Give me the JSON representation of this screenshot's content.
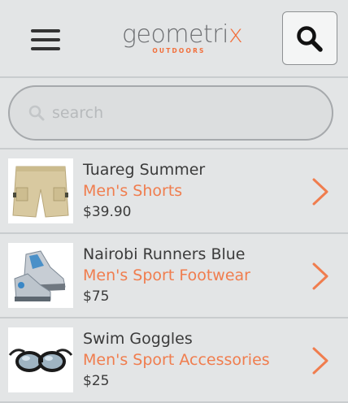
{
  "header": {
    "logo_main": "geometri",
    "logo_accent": "x",
    "logo_sub": "OUTDOORS",
    "menu_icon": "hamburger-menu-icon",
    "search_icon": "magnifier-icon"
  },
  "search": {
    "placeholder": "search",
    "value": ""
  },
  "products": [
    {
      "name": "Tuareg Summer",
      "category": "Men's Shorts",
      "price": "$39.90"
    },
    {
      "name": "Nairobi Runners Blue",
      "category": "Men's Sport Footwear",
      "price": "$75"
    },
    {
      "name": "Swim Goggles",
      "category": "Men's Sport Accessories",
      "price": "$25"
    }
  ],
  "colors": {
    "accent": "#f07d4e",
    "background": "#e3e5e6",
    "text": "#3b3b3b"
  }
}
